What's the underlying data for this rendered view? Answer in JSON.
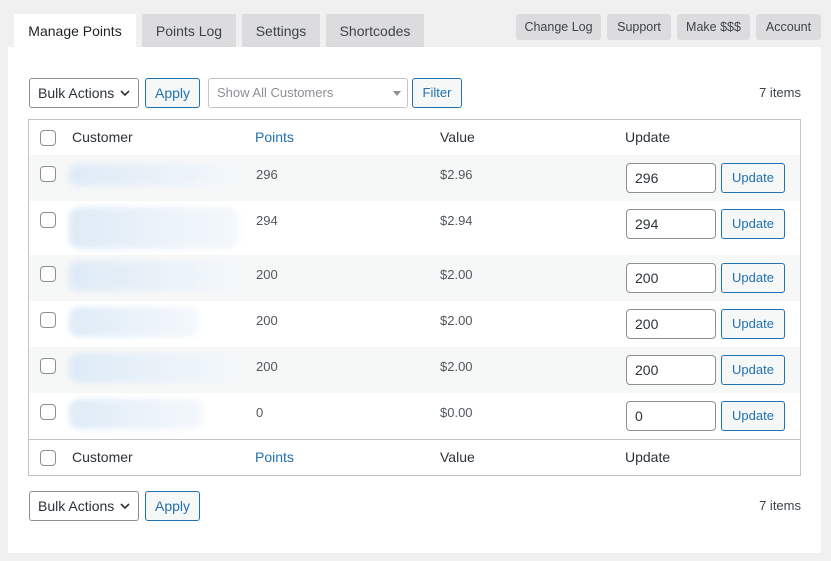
{
  "tabs": [
    {
      "label": "Manage Points",
      "active": true
    },
    {
      "label": "Points Log",
      "active": false
    },
    {
      "label": "Settings",
      "active": false
    },
    {
      "label": "Shortcodes",
      "active": false
    }
  ],
  "top_links": [
    "Change Log",
    "Support",
    "Make $$$",
    "Account"
  ],
  "toolbar": {
    "bulk_actions": "Bulk Actions",
    "apply": "Apply",
    "customer_filter_placeholder": "Show All Customers",
    "filter": "Filter",
    "items_count": "7 items"
  },
  "table": {
    "columns": {
      "customer": "Customer",
      "points": "Points",
      "value": "Value",
      "update": "Update"
    },
    "rows": [
      {
        "points": "296",
        "value": "$2.96",
        "input": "296",
        "button": "Update"
      },
      {
        "points": "294",
        "value": "$2.94",
        "input": "294",
        "button": "Update"
      },
      {
        "points": "200",
        "value": "$2.00",
        "input": "200",
        "button": "Update"
      },
      {
        "points": "200",
        "value": "$2.00",
        "input": "200",
        "button": "Update"
      },
      {
        "points": "200",
        "value": "$2.00",
        "input": "200",
        "button": "Update"
      },
      {
        "points": "0",
        "value": "$0.00",
        "input": "0",
        "button": "Update"
      }
    ]
  },
  "colors": {
    "accent": "#2271b1",
    "tab_inactive": "#dcdcde",
    "background": "#f0f0f1"
  }
}
